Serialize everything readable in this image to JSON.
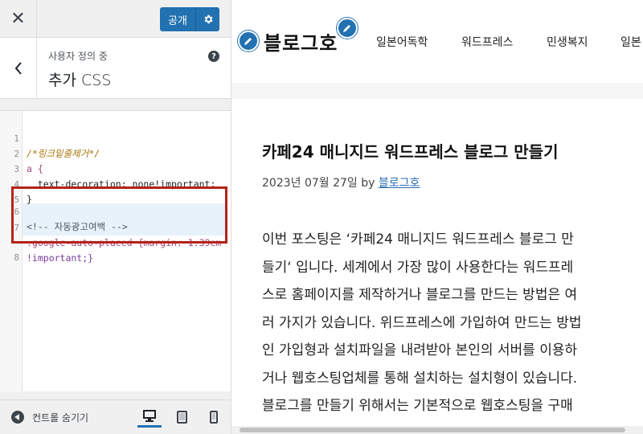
{
  "customizer": {
    "publish_label": "공개",
    "breadcrumb": "사용자 정의 중",
    "section_title": "추가 CSS",
    "help_glyph": "?",
    "code_lines": [
      {
        "n": "1",
        "text": "/*링크밑줄제거*/"
      },
      {
        "n": "2",
        "text": "a {"
      },
      {
        "n": "3",
        "text": "  text-decoration: none!important;"
      },
      {
        "n": "4",
        "text": "}"
      },
      {
        "n": "5",
        "text": ""
      },
      {
        "n": "6",
        "text": "<!-- 자동광고여백 -->"
      },
      {
        "n": "7",
        "text": ".google-auto-placed {margin: 1.39em"
      },
      {
        "n": "",
        "text": "!important;}"
      },
      {
        "n": "8",
        "text": ""
      }
    ],
    "collapse_label": "컨트롤 숨기기",
    "colors": {
      "accent": "#2271b1",
      "highlight_border": "#b42318"
    }
  },
  "preview": {
    "site_title": "블로그호",
    "nav": [
      "일본어독학",
      "워드프레스",
      "민생복지",
      "일본"
    ],
    "post": {
      "title": "카페24 매니지드 워드프레스 블로그 만들기",
      "date": "2023년 07월 27일",
      "by": "by",
      "author": "블로그호",
      "body_lines": [
        "이번 포스팅은 ‘카페24 매니지드 워드프레스 블로그 만",
        "들기‘ 입니다. 세계에서 가장 많이 사용한다는 워드프레",
        "스로 홈페이지를 제작하거나 블로그를 만드는 방법은 여",
        "러 가지가 있습니다. 위드프레스에 가입하여 만드는 방법",
        "인 가입형과 설치파일을 내려받아 본인의 서버를 이용하",
        "거나 웹호스팅업체를 통해 설치하는 설치형이 있습니다.",
        "블로그를 만들기 위해서는 기본적으로 웹호스팅을 구매"
      ]
    }
  }
}
